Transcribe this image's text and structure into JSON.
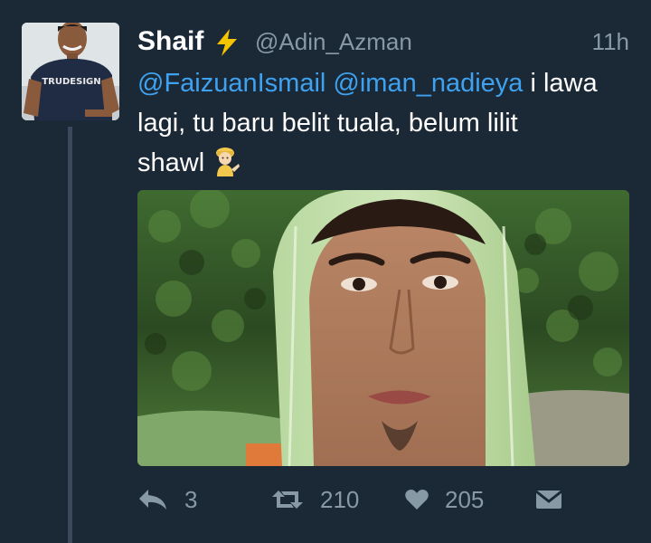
{
  "tweet": {
    "display_name": "Shaif",
    "handle": "@Adin_Azman",
    "time": "11h",
    "mention_1": "@FaizuanIsmail",
    "mention_2": "@iman_nadieya",
    "text_line_1": "i lawa",
    "text_line_2": "lagi, tu baru belit tuala, belum lilit",
    "text_line_3": "shawl",
    "avatar_shirt_text": "TRUDESIGN"
  },
  "actions": {
    "reply_count": "3",
    "retweet_count": "210",
    "like_count": "205"
  },
  "icons": {
    "bolt": "lightning-bolt-icon",
    "emoji": "information-desk-person-emoji",
    "reply": "reply-icon",
    "retweet": "retweet-icon",
    "like": "heart-icon",
    "dm": "envelope-icon"
  },
  "colors": {
    "background": "#1b2836",
    "mention": "#3ea2f0",
    "muted": "#8899a6",
    "bolt": "#f5c400"
  }
}
